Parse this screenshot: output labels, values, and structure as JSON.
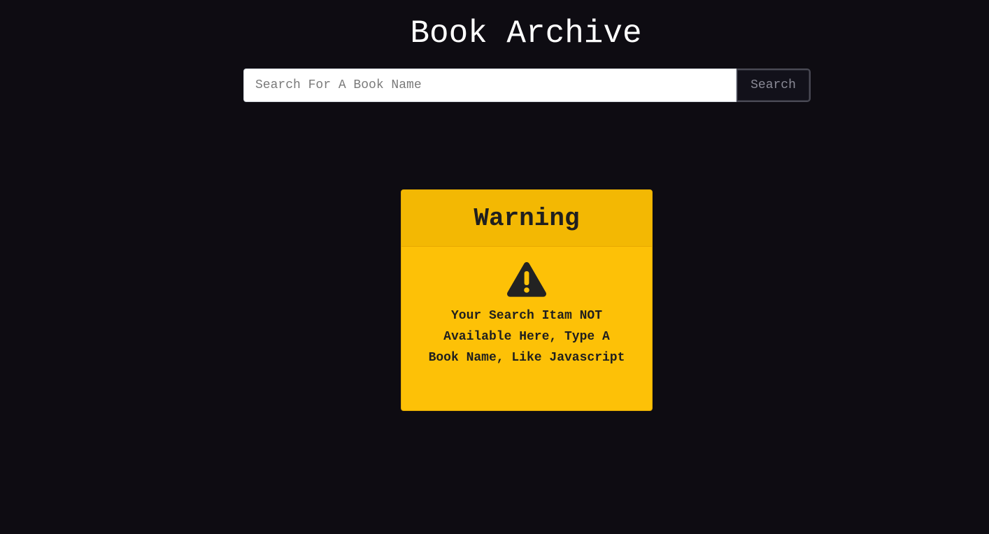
{
  "header": {
    "title": "Book Archive"
  },
  "search": {
    "placeholder": "Search For A Book Name",
    "value": "",
    "button_label": "Search"
  },
  "warning": {
    "title": "Warning",
    "icon": "exclamation-triangle-icon",
    "message": "Your Search Itam NOT Available Here, Type A Book Name, Like Javascript"
  },
  "colors": {
    "background": "#0e0c12",
    "warning_background": "#fdc107",
    "warning_header": "#f3b803",
    "text_dark": "#1f1f1f"
  }
}
